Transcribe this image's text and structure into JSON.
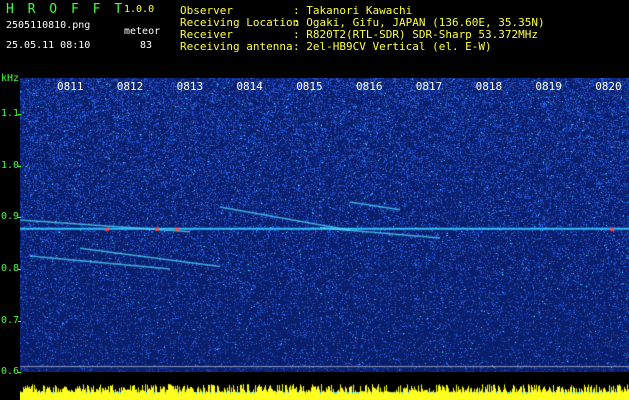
{
  "app": {
    "name": "H R O F F T",
    "version": "1.0.0",
    "filename": "2505110810.png",
    "mode": "meteor",
    "timestamp": "25.05.11 08:10",
    "count": "83"
  },
  "info": {
    "rows": [
      {
        "label": "Observer",
        "value": ": Takanori Kawachi"
      },
      {
        "label": "Receiving Location",
        "value": ": Ogaki, Gifu, JAPAN (136.60E, 35.35N)"
      },
      {
        "label": "Receiver",
        "value": ": R820T2(RTL-SDR) SDR-Sharp 53.372MHz"
      },
      {
        "label": "Receiving antenna",
        "value": ": 2el-HB9CV Vertical (el. E-W)"
      }
    ]
  },
  "spectrogram": {
    "unit": "kHz",
    "y_labels": [
      "1.1",
      "1.0",
      "0.9",
      "0.8",
      "0.7",
      "0.6"
    ],
    "y_label_values": [
      1.1,
      1.0,
      0.9,
      0.8,
      0.7,
      0.6
    ],
    "time_labels": [
      "0811",
      "0812",
      "0813",
      "0814",
      "0815",
      "0816",
      "0817",
      "0818",
      "0819",
      "0820"
    ],
    "ylim": [
      0.585,
      1.17
    ],
    "carrier_khz": 0.878,
    "colors": {
      "background": "#0a1f6b",
      "noise": "#2a5cff",
      "carrier": "#30c0ff",
      "hot": "#ff5050",
      "label": "#3fff3f"
    }
  }
}
